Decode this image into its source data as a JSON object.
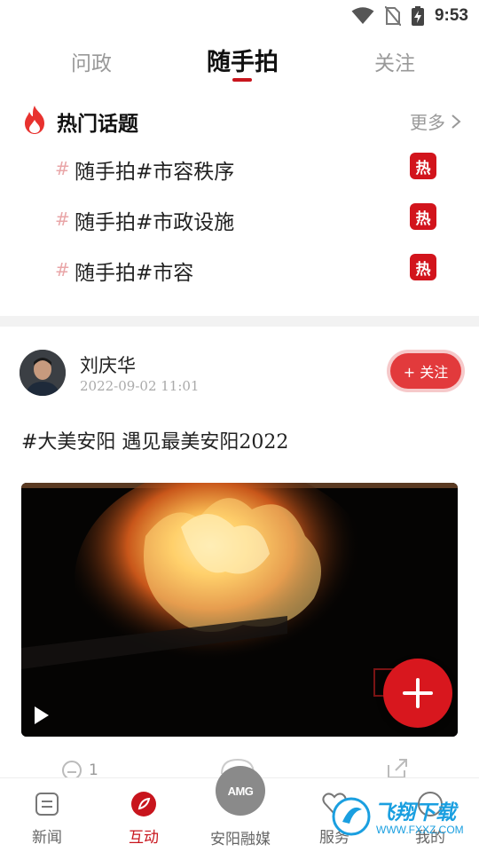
{
  "status_bar": {
    "time": "9:53",
    "icons": [
      "wifi-icon",
      "no-sim-icon",
      "battery-charging-icon"
    ]
  },
  "tabs": [
    {
      "label": "问政",
      "active": false
    },
    {
      "label": "随手拍",
      "active": true
    },
    {
      "label": "关注",
      "active": false
    }
  ],
  "hot_topics": {
    "title": "热门话题",
    "more": "更多",
    "items": [
      {
        "hash": "#",
        "text": "随手拍#市容秩序",
        "badge": "热"
      },
      {
        "hash": "#",
        "text": "随手拍#市政设施",
        "badge": "热"
      },
      {
        "hash": "#",
        "text": "随手拍#市容",
        "badge": "热"
      }
    ]
  },
  "post": {
    "author": "刘庆华",
    "time": "2022-09-02 11:01",
    "follow_label": "+ 关注",
    "text": "#大美安阳 遇见最美安阳2022",
    "comment_count": "1"
  },
  "bottom_nav": {
    "items": [
      {
        "label": "新闻",
        "icon": "news-icon"
      },
      {
        "label": "互动",
        "icon": "interact-icon",
        "active": true
      },
      {
        "label": "安阳融媒",
        "icon": "amg-logo"
      },
      {
        "label": "服务",
        "icon": "heart-icon"
      },
      {
        "label": "我的",
        "icon": "user-icon"
      }
    ],
    "center_logo_text": "AMG"
  },
  "watermark": {
    "text": "飞翔下载",
    "url": "WWW.FXXZ.COM"
  },
  "colors": {
    "accent": "#c8151d",
    "badge": "#d2141c",
    "follow": "#e23a3c"
  }
}
